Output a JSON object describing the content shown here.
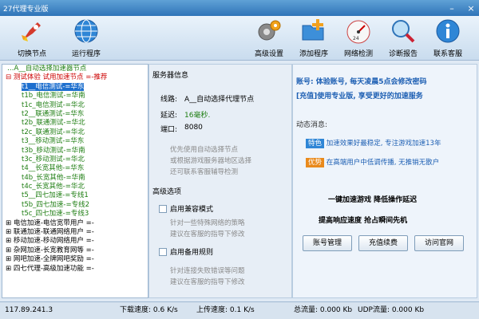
{
  "window": {
    "title": "27代理专业版"
  },
  "toolbar": {
    "switch_node": "切换节点",
    "run_program": "运行程序",
    "advanced": "高级设置",
    "add_program": "添加程序",
    "net_check": "网络检测",
    "diagnose": "诊断报告",
    "contact": "联系客服"
  },
  "tree": [
    "A__自动选择加速器节点",
    "测试体验 试用加速节点 =-推荐",
    "t1__电信测试-=华东",
    "t1b_电信测试-=华南",
    "t1c_电信测试-=华北",
    "t2__联通测试-=华东",
    "t2b_联通测试-=华北",
    "t2c_联通测试-=华北",
    "t3__移动测试-=华东",
    "t3b_移动测试-=华南",
    "t3c_移动测试-=华北",
    "t4__长宽其他-=华东",
    "t4b_长宽其他-=华南",
    "t4c_长宽其他-=华北",
    "t5__四七加速-=专线1",
    "t5b_四七加速-=专线2",
    "t5c_四七加速-=专线3",
    "电信加速-电信宽带用户 =-",
    "联通加速-联通网络用户 =-",
    "移动加速-移动网络用户 =-",
    "杂网加速-长宽教育网等 =-",
    "网吧加速-全牌网吧奖励 =-",
    "四七代理-高级加速功能 =-"
  ],
  "server": {
    "section": "服务器信息",
    "line_label": "线路:",
    "line_value": "A__自动选择代理节点",
    "delay_label": "延迟:",
    "delay_value": "16毫秒.",
    "port_label": "端口:",
    "port_value": "8080",
    "hint1": "优先使用自动选择节点",
    "hint2": "或根据游戏服务器地区选择",
    "hint3": "还可联系客服辅导检测"
  },
  "advanced": {
    "section": "高级选项",
    "opt1": "启用兼容模式",
    "opt1_hint1": "针对一些特殊网络的策略",
    "opt1_hint2": "建议在客服的指导下修改",
    "opt2": "启用备用规则",
    "opt2_hint1": "针对连接失败错误等问题",
    "opt2_hint2": "建议在客服的指导下修改"
  },
  "account": {
    "line1": "账号: 体验账号, 每天凌晨5点会修改密码",
    "line2": "[充值]使用专业版, 享受更好的加速服务",
    "news_title": "动态消息:",
    "news1_tag": "特色",
    "news1": "加速效果好最稳定, 专注游戏加速13年",
    "news2_tag": "优势",
    "news2": "在高端用户中低调传播, 无推销无散户",
    "slogan1": "一键加速游戏  降低操作延迟",
    "slogan2": "提高响应速度  抢占瞬间先机",
    "btn_account": "账号管理",
    "btn_recharge": "充值续费",
    "btn_site": "访问官网"
  },
  "status": {
    "ip": "117.89.241.3",
    "down": "下载速度: 0.6 K/s",
    "up": "上传速度: 0.1 K/s",
    "total": "总流量: 0.000 Kb",
    "udp": "UDP流量: 0.000 Kb"
  },
  "colors": {
    "accent": "#2f74b8",
    "green": "#1d7d11",
    "red": "#c00000",
    "blue_text": "#1d5fb3",
    "tag_blue": "#2f86d6",
    "tag_orange": "#e98a1c"
  }
}
